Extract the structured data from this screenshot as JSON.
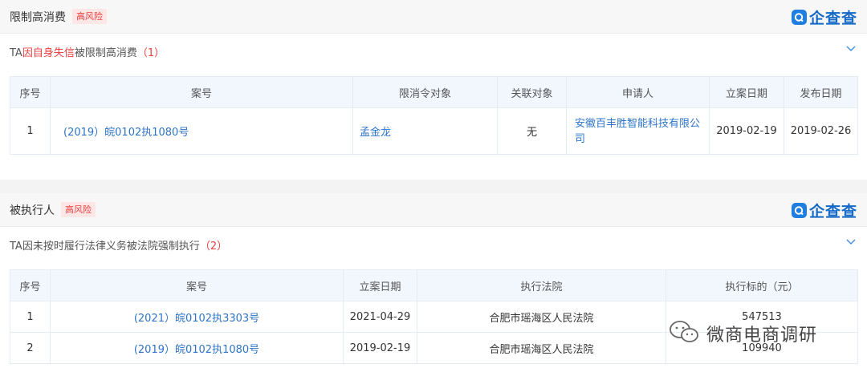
{
  "brand_name": "企查查",
  "risk_label": "高风险",
  "section1": {
    "title": "限制高消费",
    "subtitle_prefix": "TA",
    "subtitle_highlight": "因自身失信",
    "subtitle_rest": "被限制高消费",
    "subtitle_count": "（1）",
    "columns": [
      "序号",
      "案号",
      "限消令对象",
      "关联对象",
      "申请人",
      "立案日期",
      "发布日期"
    ],
    "rows": [
      {
        "index": "1",
        "case_no": "(2019）皖0102执1080号",
        "target": "孟金龙",
        "related": "无",
        "applicant": "安徽百丰胜智能科技有限公司",
        "filing_date": "2019-02-19",
        "publish_date": "2019-02-26"
      }
    ]
  },
  "section2": {
    "title": "被执行人",
    "subtitle_text": "TA因未按时履行法律义务被法院强制执行",
    "subtitle_count": "（2）",
    "columns": [
      "序号",
      "案号",
      "立案日期",
      "执行法院",
      "执行标的（元）"
    ],
    "rows": [
      {
        "index": "1",
        "case_no": "(2021）皖0102执3303号",
        "filing_date": "2021-04-29",
        "court": "合肥市瑶海区人民法院",
        "amount": "547513"
      },
      {
        "index": "2",
        "case_no": "(2019）皖0102执1080号",
        "filing_date": "2019-02-19",
        "court": "合肥市瑶海区人民法院",
        "amount": "109940"
      }
    ]
  },
  "watermark": "微商电商调研"
}
